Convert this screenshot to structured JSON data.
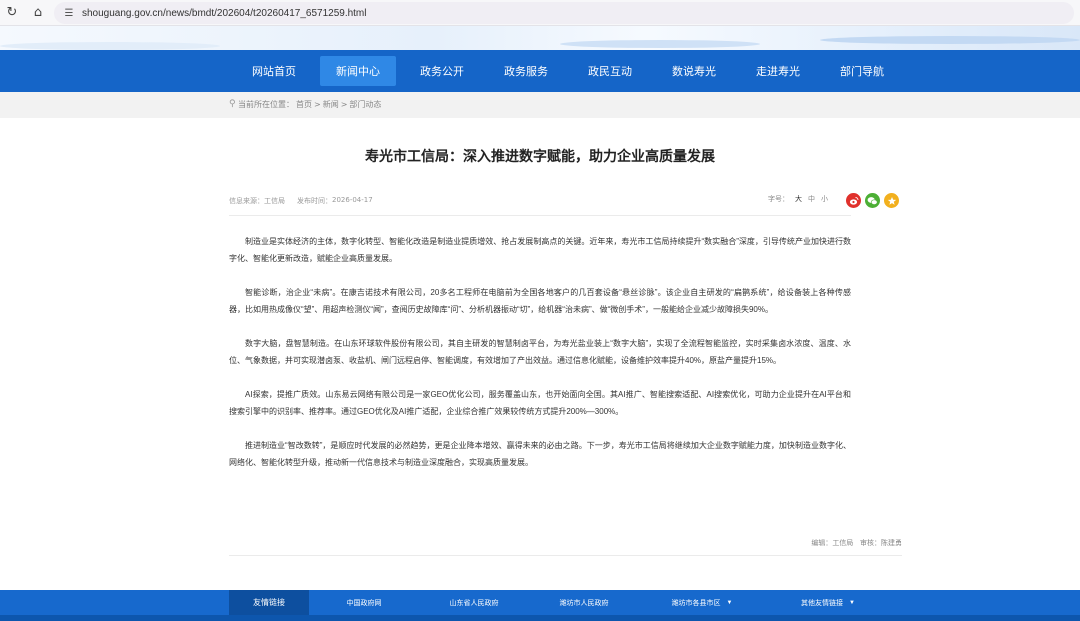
{
  "browser": {
    "url": "shouguang.gov.cn/news/bmdt/202604/t20260417_6571259.html"
  },
  "nav": {
    "items": [
      "网站首页",
      "新闻中心",
      "政务公开",
      "政务服务",
      "政民互动",
      "数说寿光",
      "走进寿光",
      "部门导航"
    ],
    "active_index": 1
  },
  "breadcrumb": {
    "prefix": "当前所在位置：",
    "items": [
      "首页",
      "新闻",
      "部门动态"
    ],
    "separator": ">"
  },
  "article": {
    "title": "寿光市工信局：深入推进数字赋能，助力企业高质量发展",
    "source_label": "信息来源：",
    "source": "工信局",
    "date_label": "发布时间：",
    "date": "2026-04-17",
    "font_label": "字号：",
    "font_sizes": [
      "大",
      "中",
      "小"
    ],
    "paragraphs": [
      "制造业是实体经济的主体，数字化转型、智能化改造是制造业提质增效、抢占发展制高点的关键。近年来，寿光市工信局持续提升“数实融合”深度，引导传统产业加快进行数字化、智能化更新改造，赋能企业高质量发展。",
      "智能诊断，治企业“未病”。在康吉诺技术有限公司，20多名工程师在电脑前为全国各地客户的几百套设备“悬丝诊脉”。该企业自主研发的“扁鹊系统”，给设备装上各种传感器，比如用热成像仪“望”、用超声检测仪“闻”，查阅历史故障库“问”、分析机器振动“切”，给机器“治未病”、做“微创手术”，一般能给企业减少故障损失90%。",
      "数字大脑，盘智慧制造。在山东环球软件股份有限公司，其自主研发的智慧制卤平台，为寿光盐业装上“数字大脑”，实现了全流程智能监控，实时采集卤水浓度、温度、水位、气象数据，并可实现潜卤泵、收盐机、闸门远程启停、智能调度，有效增加了产出效益。通过信息化赋能，设备维护效率提升40%，原盐产量提升15%。",
      "AI探索，提推广质效。山东易云网络有限公司是一家GEO优化公司，服务覆盖山东，也开始面向全国。其AI推广、智能搜索适配、AI搜索优化，可助力企业提升在AI平台和搜索引擎中的识别率、推荐率。通过GEO优化及AI推广适配，企业综合推广效果较传统方式提升200%—300%。",
      "推进制造业“智改数转”，是顺应时代发展的必然趋势，更是企业降本增效、赢得未来的必由之路。下一步，寿光市工信局将继续加大企业数字赋能力度，加快制造业数字化、网络化、智能化转型升级，推动新一代信息技术与制造业深度融合，实现高质量发展。"
    ],
    "editor_label": "编辑：",
    "editor": "工信局",
    "reviewer_label": "审核：",
    "reviewer": "陈建勇"
  },
  "footer": {
    "heading": "友情链接",
    "links": [
      "中国政府网",
      "山东省人民政府",
      "潍坊市人民政府"
    ],
    "dropdowns": [
      "潍坊市各县市区",
      "其他友情链接"
    ]
  },
  "icons": {
    "reload": "reload-icon",
    "home": "home-icon",
    "site_info": "site-info-icon",
    "location": "location-pin-icon",
    "weibo": "weibo-share-icon",
    "wechat": "wechat-share-icon",
    "favorite": "favorite-star-icon"
  },
  "colors": {
    "nav_blue": "#1565c8",
    "nav_active": "#2f88e6",
    "footer_blue": "#1769cd",
    "weibo_red": "#e0312c",
    "wechat_green": "#4caf35",
    "star_yellow": "#f2b01e"
  }
}
